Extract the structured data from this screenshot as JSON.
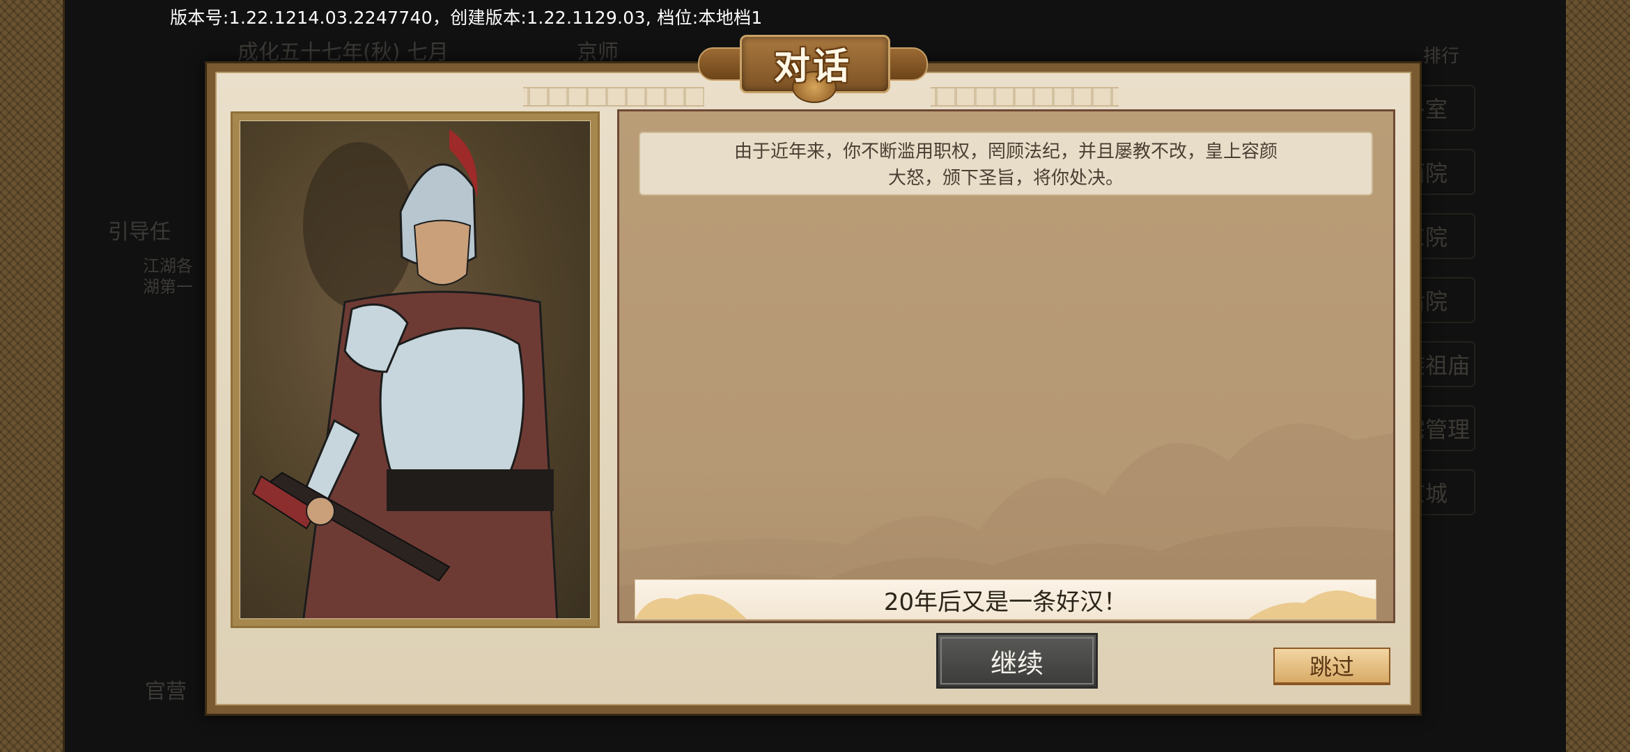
{
  "version_info": "版本号:1.22.1214.03.2247740，创建版本:1.22.1129.03, 档位:本地档1",
  "background": {
    "date": "成化五十七年(秋) 七月",
    "location": "京师",
    "left_labels": [
      "引导任",
      "江湖各",
      "湖第一"
    ],
    "bottom_label": "官营",
    "right_items": [
      "卧室",
      "西院",
      "东院",
      "后院",
      "家族祖庙",
      "自宅管理",
      "京城"
    ],
    "top_right_label": "排行"
  },
  "dialog": {
    "title": "对话",
    "narration": "由于近年来，你不断滥用职权，罔顾法纪，并且屡教不改，皇上容颜大怒，颁下圣旨，将你处决。",
    "speech": "20年后又是一条好汉！",
    "continue_label": "继续",
    "skip_label": "跳过"
  },
  "colors": {
    "frame": "#7a5a31",
    "parchment": "#e2d6bd",
    "text_panel": "#b59874",
    "continue_button": "#4a4b49",
    "skip_button": "#e4bd7f"
  }
}
